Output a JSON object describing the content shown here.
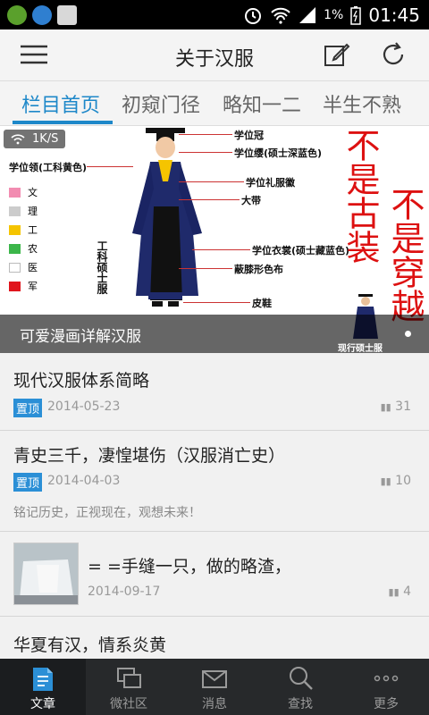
{
  "status_bar": {
    "battery": "1%",
    "time": "01:45"
  },
  "app_bar": {
    "title": "关于汉服",
    "menu_icon": "menu-icon",
    "edit_icon": "edit-icon",
    "refresh_icon": "refresh-icon"
  },
  "tabs": [
    {
      "label": "栏目首页",
      "active": true
    },
    {
      "label": "初窥门径",
      "active": false
    },
    {
      "label": "略知一二",
      "active": false
    },
    {
      "label": "半生不熟",
      "active": false
    }
  ],
  "banner": {
    "speed": "1K/S",
    "caption": "可爱漫画详解汉服",
    "image_text": {
      "collar_title": "学位领(工科黄色)",
      "legend": [
        {
          "label": "文",
          "color": "#f28cb1"
        },
        {
          "label": "理",
          "color": "#cccccc"
        },
        {
          "label": "工",
          "color": "#f5c400"
        },
        {
          "label": "农",
          "color": "#3cb64a"
        },
        {
          "label": "医",
          "color": "#ffffff"
        },
        {
          "label": "军",
          "color": "#e0141c"
        }
      ],
      "labels": [
        "学位冠",
        "学位缨(硕士深蓝色)",
        "学位礼服徽",
        "大带",
        "学位衣裳(硕士藏蓝色)",
        "蔽膝形色布",
        "皮鞋"
      ],
      "vertical_label": "工科硕士服",
      "slogan_1": "不是古装",
      "slogan_2": "不是穿越",
      "small_caption": "现行硕士服"
    }
  },
  "articles": [
    {
      "title": "现代汉服体系简略",
      "tag": "置顶",
      "date": "2014-05-23",
      "count": "31"
    },
    {
      "title": "青史三千，凄惶堪伤（汉服消亡史）",
      "tag": "置顶",
      "date": "2014-04-03",
      "count": "10",
      "summary": "铭记历史，正视现在，观想未来！"
    },
    {
      "title": "= =手缝一只，做的略渣，",
      "date": "2014-09-17",
      "count": "4"
    },
    {
      "title": "华夏有汉，情系炎黄"
    }
  ],
  "bottom_nav": [
    {
      "label": "文章",
      "icon": "article-icon",
      "active": true
    },
    {
      "label": "微社区",
      "icon": "community-icon",
      "active": false
    },
    {
      "label": "消息",
      "icon": "message-icon",
      "active": false
    },
    {
      "label": "查找",
      "icon": "search-icon",
      "active": false
    },
    {
      "label": "更多",
      "icon": "more-icon",
      "active": false
    }
  ]
}
